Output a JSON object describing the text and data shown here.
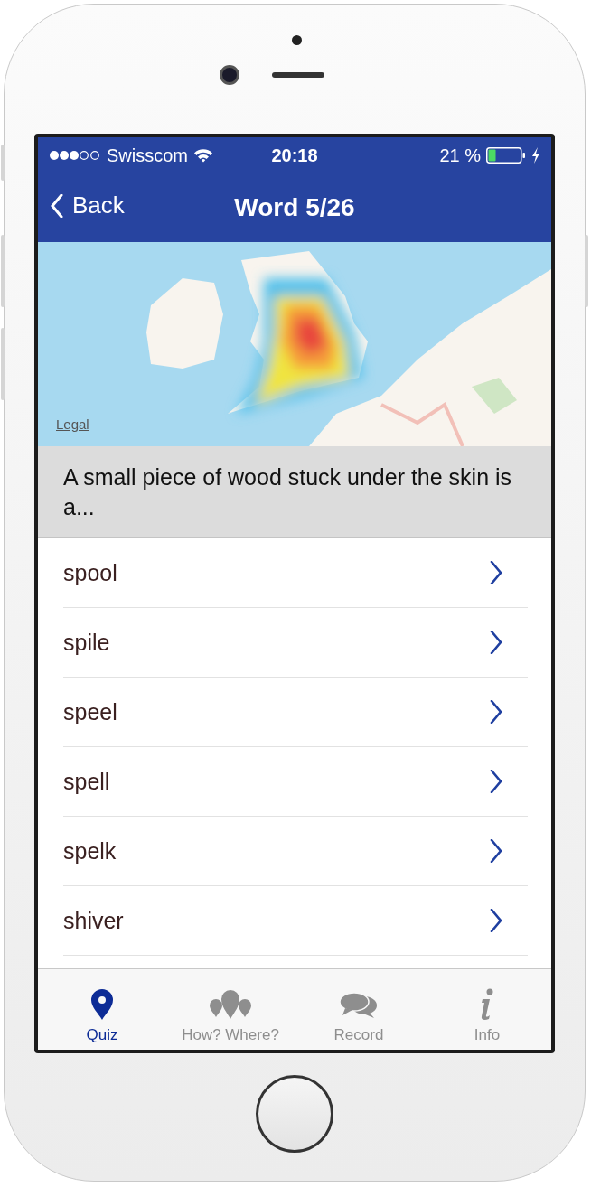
{
  "status_bar": {
    "carrier": "Swisscom",
    "time": "20:18",
    "battery": "21 %"
  },
  "nav_bar": {
    "back": "Back",
    "title": "Word 5/26"
  },
  "map": {
    "kind": "picture",
    "legal": "Legal"
  },
  "question": "A small piece of wood stuck under the skin is a...",
  "answers": [
    {
      "label": "spool"
    },
    {
      "label": "spile"
    },
    {
      "label": "speel"
    },
    {
      "label": "spell"
    },
    {
      "label": "spelk"
    },
    {
      "label": "shiver"
    }
  ],
  "tabs": [
    {
      "label": "Quiz",
      "kind": "pin",
      "selected": true
    },
    {
      "label": "How? Where?",
      "kind": "pins",
      "selected": false
    },
    {
      "label": "Record",
      "kind": "chat",
      "selected": false
    },
    {
      "label": "Info",
      "kind": "info",
      "selected": false
    }
  ]
}
